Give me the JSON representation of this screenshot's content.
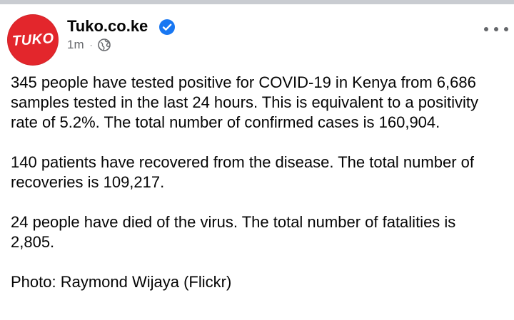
{
  "header": {
    "page_name": "Tuko.co.ke",
    "avatar_logo": "TUKO",
    "time": "1m",
    "separator": "·",
    "verified_icon": "verified-badge-icon",
    "audience_icon": "globe-icon",
    "more_icon": "more-options-icon"
  },
  "colors": {
    "brand_red": "#e3262c",
    "verified_blue": "#1877f2",
    "meta_gray": "#65676b",
    "text": "#050505"
  },
  "post": {
    "paragraphs": [
      "345 people have tested positive for COVID-19 in Kenya from 6,686 samples tested in the last 24 hours. This is equivalent to a positivity rate of 5.2%. The total number of confirmed cases is 160,904.",
      "140 patients have recovered from the disease. The total number of recoveries is 109,217.",
      "24 people have died of the virus. The total number of fatalities is 2,805.",
      "Photo: Raymond Wijaya (Flickr)"
    ]
  }
}
